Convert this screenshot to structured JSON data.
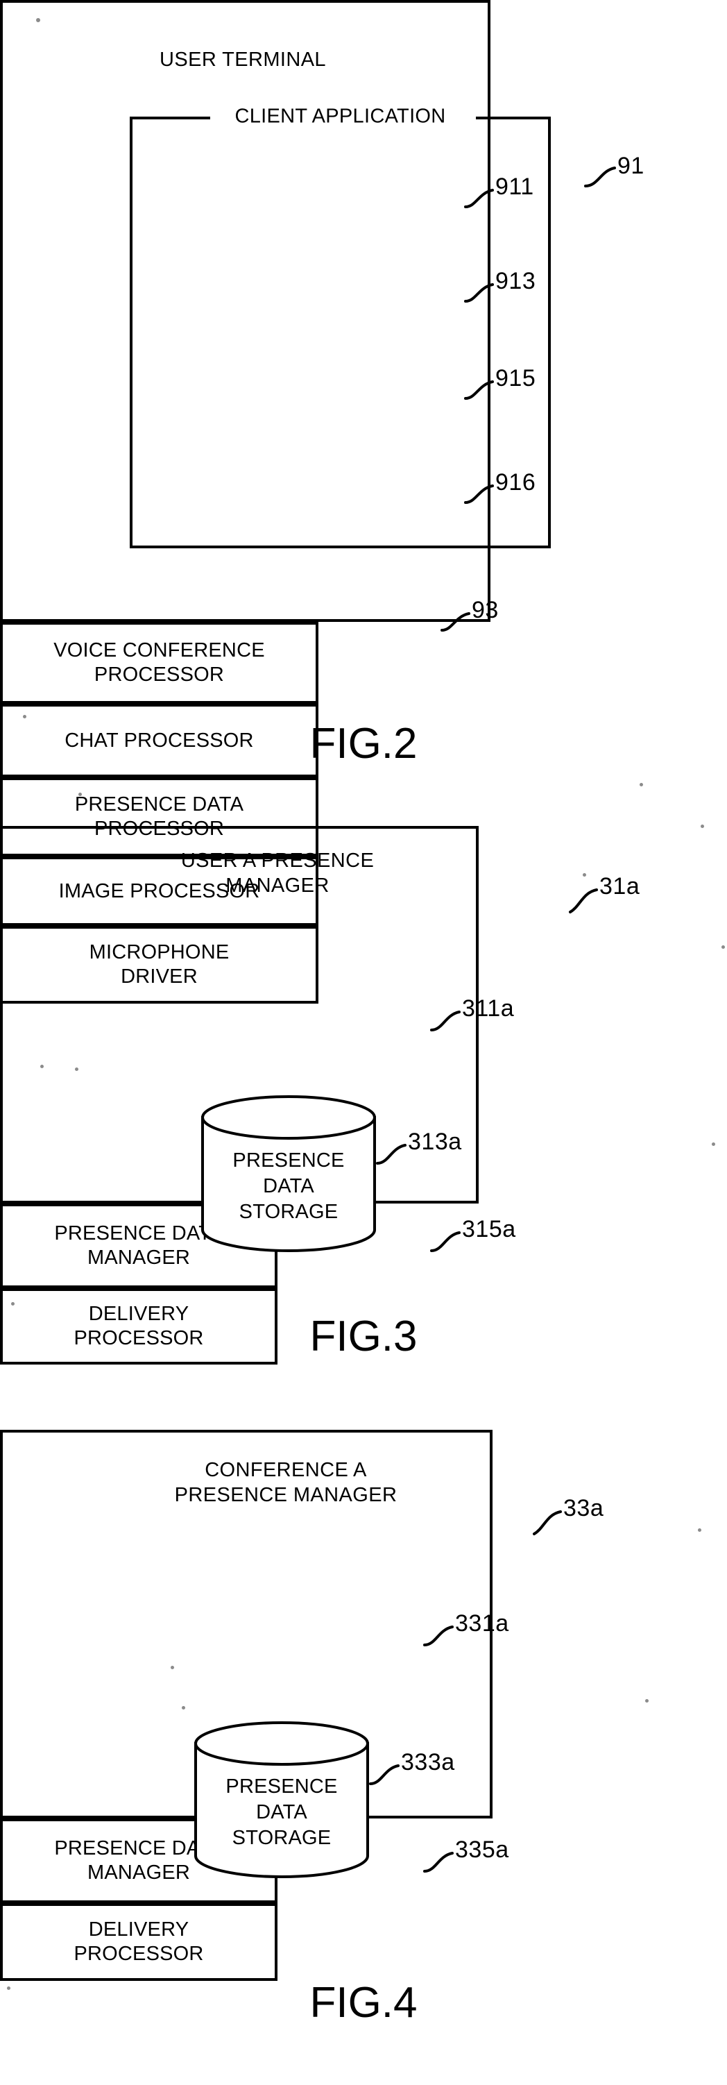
{
  "document": {
    "type": "patent-drawing-sheet",
    "figures": [
      "FIG.2",
      "FIG.3",
      "FIG.4"
    ]
  },
  "fig2": {
    "caption": "FIG.2",
    "title": "USER TERMINAL",
    "outer_ref": "91",
    "inner_group_label": "CLIENT APPLICATION",
    "blocks": [
      {
        "label": "VOICE CONFERENCE\nPROCESSOR",
        "ref": "911"
      },
      {
        "label": "CHAT PROCESSOR",
        "ref": "913"
      },
      {
        "label": "PRESENCE DATA\nPROCESSOR",
        "ref": "915"
      },
      {
        "label": "IMAGE PROCESSOR",
        "ref": "916"
      }
    ],
    "driver_block": {
      "label": "MICROPHONE\nDRIVER",
      "ref": "93"
    }
  },
  "fig3": {
    "caption": "FIG.3",
    "title": "USER A PRESENCE\nMANAGER",
    "outer_ref": "31a",
    "blocks": [
      {
        "label": "PRESENCE DATA\nMANAGER",
        "ref": "311a",
        "shape": "rect"
      },
      {
        "label": "PRESENCE\nDATA\nSTORAGE",
        "ref": "313a",
        "shape": "cylinder"
      },
      {
        "label": "DELIVERY\nPROCESSOR",
        "ref": "315a",
        "shape": "rect"
      }
    ]
  },
  "fig4": {
    "caption": "FIG.4",
    "title": "CONFERENCE A\nPRESENCE MANAGER",
    "outer_ref": "33a",
    "blocks": [
      {
        "label": "PRESENCE DATA\nMANAGER",
        "ref": "331a",
        "shape": "rect"
      },
      {
        "label": "PRESENCE\nDATA\nSTORAGE",
        "ref": "333a",
        "shape": "cylinder"
      },
      {
        "label": "DELIVERY\nPROCESSOR",
        "ref": "335a",
        "shape": "rect"
      }
    ]
  },
  "colors": {
    "ink": "#000000",
    "paper": "#ffffff"
  }
}
